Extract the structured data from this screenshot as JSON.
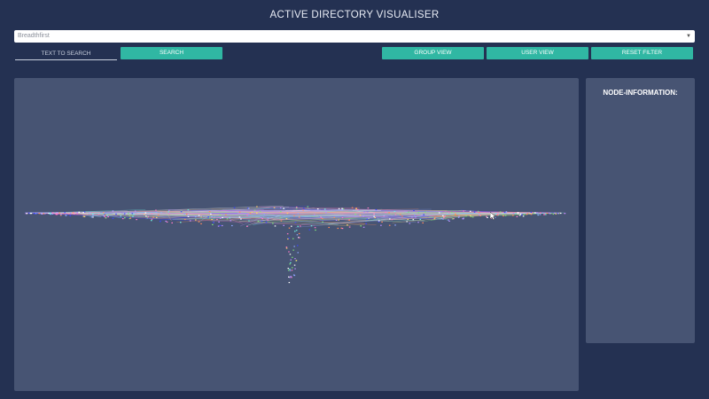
{
  "app": {
    "title": "ACTIVE DIRECTORY VISUALISER"
  },
  "layout_select": {
    "selected": "Breadthfirst"
  },
  "search": {
    "placeholder": "TEXT TO SEARCH",
    "button_label": "SEARCH"
  },
  "views": {
    "group_view_label": "GROUP VIEW",
    "user_view_label": "USER VIEW",
    "reset_filter_label": "RESET FILTER"
  },
  "info_panel": {
    "title": "NODE-INFORMATION:"
  },
  "colors": {
    "background": "#243152",
    "panel": "#475473",
    "accent": "#30b7a3"
  },
  "icons": {
    "dropdown": "chevron-down-icon",
    "cursor": "mouse-pointer-icon"
  }
}
